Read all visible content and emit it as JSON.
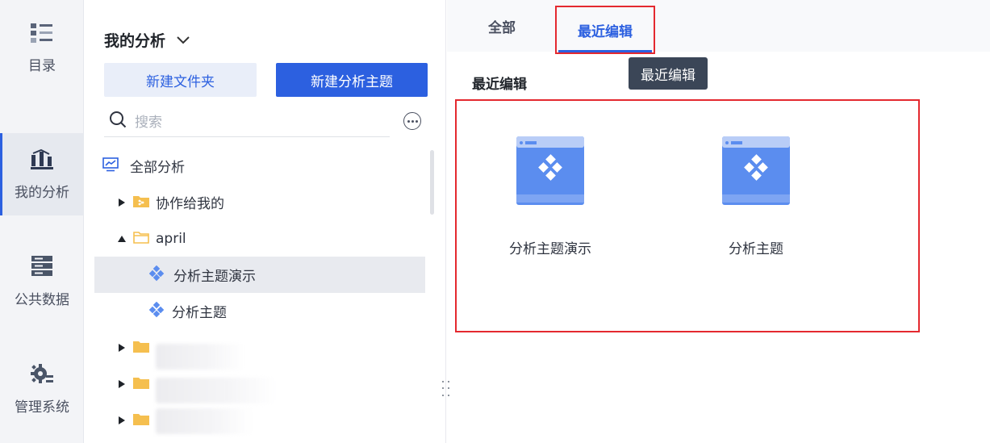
{
  "rail": {
    "items": [
      {
        "label": "目录",
        "icon": "catalog-icon",
        "active": false
      },
      {
        "label": "我的分析",
        "icon": "analysis-chart-icon",
        "active": true
      },
      {
        "label": "公共数据",
        "icon": "database-icon",
        "active": false
      },
      {
        "label": "管理系统",
        "icon": "gear-icon",
        "active": false
      }
    ]
  },
  "panel": {
    "title": "我的分析",
    "new_folder_label": "新建文件夹",
    "new_theme_label": "新建分析主题",
    "search_placeholder": "搜索",
    "tree": [
      {
        "label": "全部分析",
        "icon": "analysis-monitor-icon"
      },
      {
        "label": "协作给我的",
        "icon": "shared-folder-icon",
        "expanded": false
      },
      {
        "label": "april",
        "icon": "folder-open-icon",
        "expanded": true
      },
      {
        "label": "分析主题演示",
        "icon": "theme-icon",
        "selected": true
      },
      {
        "label": "分析主题",
        "icon": "theme-icon"
      },
      {
        "label": "",
        "icon": "folder-icon",
        "expanded": false
      },
      {
        "label": "",
        "icon": "folder-icon",
        "expanded": false
      },
      {
        "label": "",
        "icon": "folder-icon",
        "expanded": false
      }
    ]
  },
  "main": {
    "tabs": [
      {
        "label": "全部",
        "active": false
      },
      {
        "label": "最近编辑",
        "active": true
      }
    ],
    "tooltip": "最近编辑",
    "section_title": "最近编辑",
    "cards": [
      {
        "name": "分析主题演示",
        "icon": "analysis-theme-thumbnail-icon"
      },
      {
        "name": "分析主题",
        "icon": "analysis-theme-thumbnail-icon"
      }
    ]
  },
  "colors": {
    "accent": "#2c60e0",
    "highlight_border": "#e4292f",
    "folder": "#f5bf4f",
    "thumbnail": "#5b8def"
  }
}
